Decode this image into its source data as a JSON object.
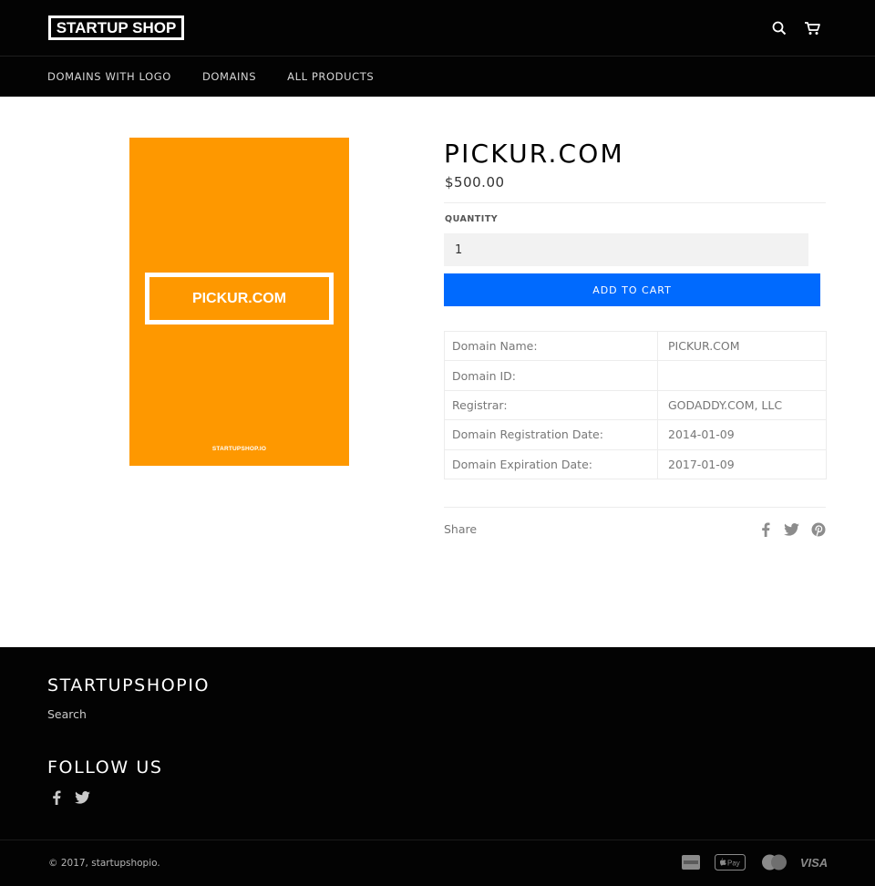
{
  "header": {
    "logo_text": "STARTUP SHOP",
    "nav": [
      {
        "label": "DOMAINS WITH LOGO"
      },
      {
        "label": "DOMAINS"
      },
      {
        "label": "ALL PRODUCTS"
      }
    ],
    "icons": [
      "search-icon",
      "cart-icon"
    ]
  },
  "product": {
    "image": {
      "center_text": "PICKUR.COM",
      "footer_text": "STARTUPSHOP.IO",
      "background": "#fe9800"
    },
    "title": "PICKUR.COM",
    "price": "$500.00",
    "quantity_label": "QUANTITY",
    "quantity_value": "1",
    "add_to_cart_label": "ADD TO CART",
    "add_to_cart_color": "#006afe",
    "details": [
      {
        "key": "Domain Name:",
        "value": "PICKUR.COM"
      },
      {
        "key": "Domain ID:",
        "value": ""
      },
      {
        "key": "Registrar:",
        "value": "GODADDY.COM, LLC"
      },
      {
        "key": "Domain Registration Date:",
        "value": "2014-01-09"
      },
      {
        "key": "Domain Expiration Date:",
        "value": "2017-01-09"
      }
    ],
    "share_label": "Share",
    "share_icons": [
      "facebook-icon",
      "twitter-icon",
      "pinterest-icon"
    ]
  },
  "footer": {
    "brand_title": "STARTUPSHOPIO",
    "links": [
      "Search"
    ],
    "follow_title": "FOLLOW US",
    "social_icons": [
      "facebook-icon",
      "twitter-icon"
    ],
    "copyright": "© 2017, startupshopio.",
    "payment_icons": [
      "american-express-icon",
      "apple-pay-icon",
      "mastercard-icon",
      "visa-icon"
    ],
    "visa_text": "VISA"
  }
}
